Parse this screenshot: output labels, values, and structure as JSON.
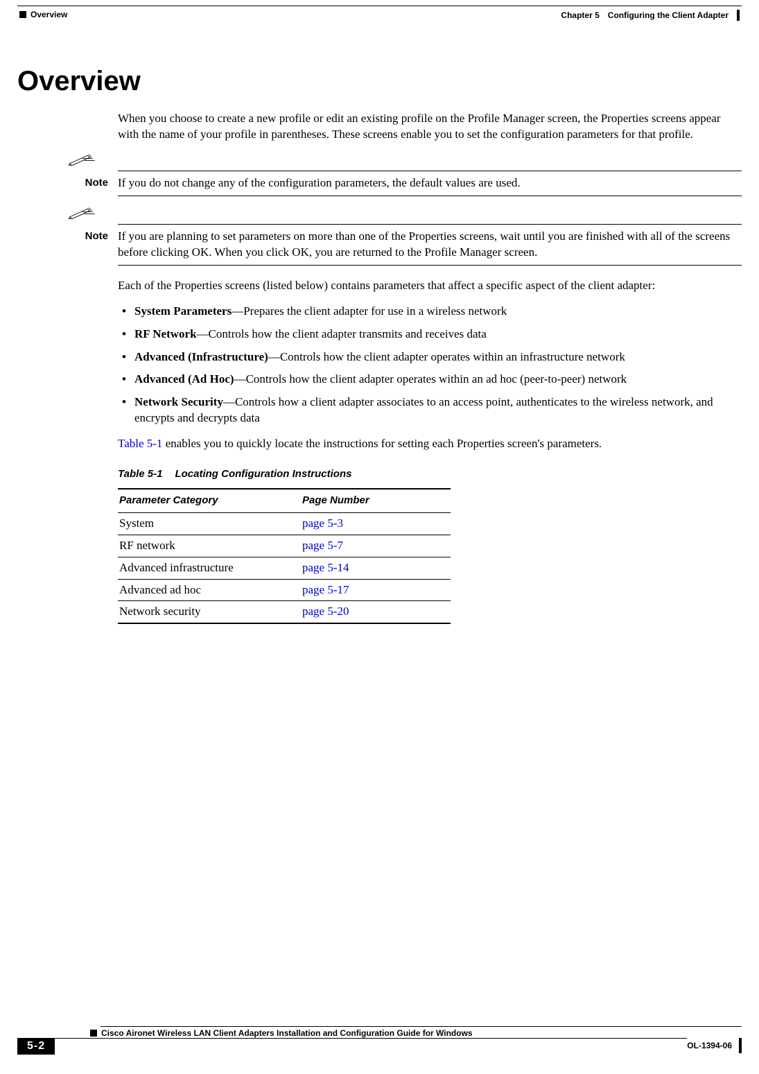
{
  "header": {
    "section": "Overview",
    "chapter": "Chapter 5",
    "chapter_title": "Configuring the Client Adapter"
  },
  "title": "Overview",
  "intro": "When you choose to create a new profile or edit an existing profile on the Profile Manager screen, the Properties screens appear with the name of your profile in parentheses. These screens enable you to set the configuration parameters for that profile.",
  "note1": {
    "label": "Note",
    "text": "If you do not change any of the configuration parameters, the default values are used."
  },
  "note2": {
    "label": "Note",
    "text": "If you are planning to set parameters on more than one of the Properties screens, wait until you are finished with all of the screens before clicking OK. When you click OK, you are returned to the Profile Manager screen."
  },
  "para2": "Each of the Properties screens (listed below) contains parameters that affect a specific aspect of the client adapter:",
  "bullets": [
    {
      "bold": "System Parameters",
      "rest": "—Prepares the client adapter for use in a wireless network"
    },
    {
      "bold": "RF Network",
      "rest": "—Controls how the client adapter transmits and receives data"
    },
    {
      "bold": "Advanced (Infrastructure)",
      "rest": "—Controls how the client adapter operates within an infrastructure network"
    },
    {
      "bold": "Advanced (Ad Hoc)",
      "rest": "—Controls how the client adapter operates within an ad hoc (peer-to-peer) network"
    },
    {
      "bold": "Network Security",
      "rest": "—Controls how a client adapter associates to an access point, authenticates to the wireless network, and encrypts and decrypts data"
    }
  ],
  "xref_sentence": {
    "link": "Table 5-1",
    "rest": " enables you to quickly locate the instructions for setting each Properties screen's parameters."
  },
  "table": {
    "caption_num": "Table 5-1",
    "caption_title": "Locating Configuration Instructions",
    "headers": {
      "col1": "Parameter Category",
      "col2": "Page Number"
    },
    "rows": [
      {
        "category": "System",
        "page": "page 5-3"
      },
      {
        "category": "RF network",
        "page": "page 5-7"
      },
      {
        "category": "Advanced infrastructure",
        "page": "page 5-14"
      },
      {
        "category": "Advanced ad hoc",
        "page": "page 5-17"
      },
      {
        "category": "Network security",
        "page": "page 5-20"
      }
    ]
  },
  "footer": {
    "doc_title": "Cisco Aironet Wireless LAN Client Adapters Installation and Configuration Guide for Windows",
    "page_num": "5-2",
    "doc_id": "OL-1394-06"
  }
}
